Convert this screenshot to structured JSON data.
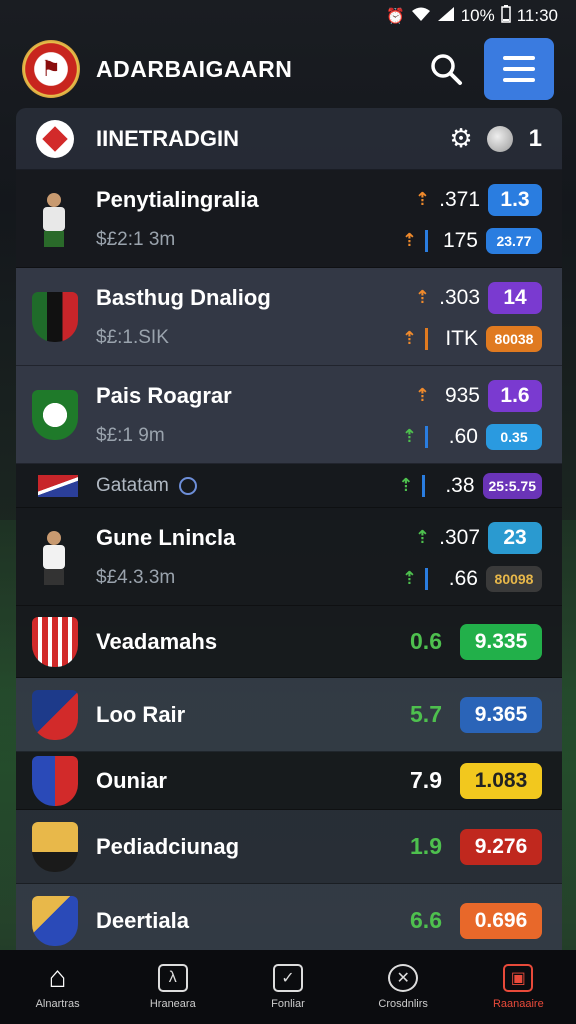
{
  "status_bar": {
    "battery": "10%",
    "time": "11:30",
    "icons": [
      "alarm-icon",
      "wifi-icon",
      "signal-icon"
    ]
  },
  "app": {
    "title": "ADARBAIGAARN"
  },
  "section": {
    "title": "IINETRADGIN",
    "count": "1"
  },
  "colors": {
    "accent_blue": "#3a7be0",
    "blue_pill": "#2a7de0",
    "purple_pill": "#7a3ad0",
    "orange_pill": "#e07a20",
    "green_pill": "#22b04a",
    "yellow_pill": "#f2c81e",
    "red_pill": "#c0281e",
    "nav_active": "#e84a3a"
  },
  "matches": [
    {
      "name": "Penytialingralia",
      "sub": "$£2:1 3m",
      "odd_top": ".371",
      "pill_top": "1.3",
      "odd_bottom": "175",
      "pill_bottom": "23.77"
    },
    {
      "name": "Basthug Dnaliog",
      "sub": "$£:1.SIK",
      "odd_top": ".303",
      "pill_top": "14",
      "odd_bottom": "ITK",
      "pill_bottom": "80038"
    },
    {
      "name": "Pais Roagrar",
      "sub": "$£:1 9m",
      "odd_top": "935",
      "pill_top": "1.6",
      "odd_bottom": ".60",
      "pill_bottom": "0.35"
    },
    {
      "name": "Gatatam",
      "odd": ".38",
      "pill": "25:5.75"
    },
    {
      "name": "Gune Lnincla",
      "sub": "$£4.3.3m",
      "odd_top": ".307",
      "pill_top": "23",
      "odd_bottom": ".66",
      "pill_bottom": "80098"
    }
  ],
  "teams": [
    {
      "name": "Veadamahs",
      "odd": "0.6",
      "pill": "9.335"
    },
    {
      "name": "Loo Rair",
      "odd": "5.7",
      "pill": "9.365"
    },
    {
      "name": "Ouniar",
      "odd": "7.9",
      "pill": "1.083"
    },
    {
      "name": "Pediadciunag",
      "odd": "1.9",
      "pill": "9.276"
    },
    {
      "name": "Deertiala",
      "odd": "6.6",
      "pill": "0.696"
    }
  ],
  "nav": [
    {
      "label": "Alnartras",
      "icon": "home-icon"
    },
    {
      "label": "Hraneara",
      "icon": "lambda-icon"
    },
    {
      "label": "Fonliar",
      "icon": "box-check-icon"
    },
    {
      "label": "Crosdnlirs",
      "icon": "gauge-icon"
    },
    {
      "label": "Raanaaire",
      "icon": "ticket-icon"
    }
  ]
}
